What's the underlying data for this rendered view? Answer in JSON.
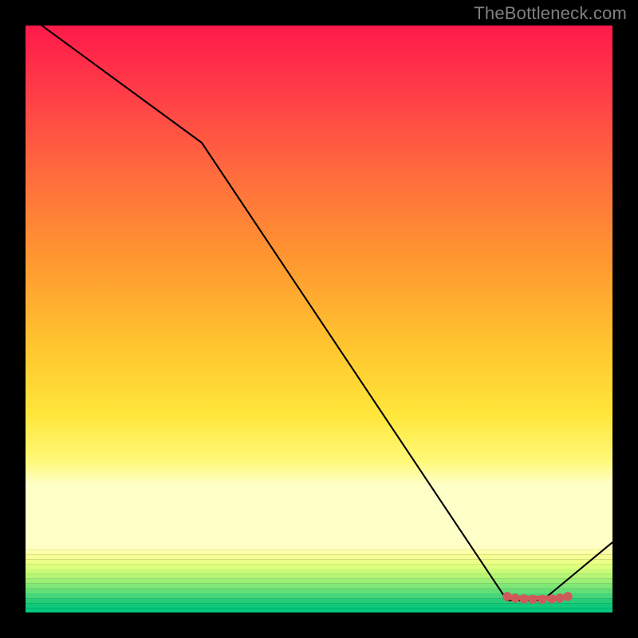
{
  "attribution": "TheBottleneck.com",
  "chart_data": {
    "type": "line",
    "title": "",
    "xlabel": "",
    "ylabel": "",
    "x_range": [
      0,
      100
    ],
    "y_range": [
      0,
      100
    ],
    "series": [
      {
        "name": "curve",
        "x": [
          0,
          30,
          82,
          88,
          100
        ],
        "y": [
          102,
          80,
          2,
          2,
          12
        ]
      }
    ],
    "marker_region": {
      "name": "highlight",
      "x_start": 82,
      "x_end": 92,
      "y": 2.5,
      "color": "#cf5a5a"
    },
    "background": {
      "type": "vertical-gradient-with-bands",
      "stops": [
        {
          "pos": 0.0,
          "color": "#ff1a4a"
        },
        {
          "pos": 0.5,
          "color": "#ff9a2b"
        },
        {
          "pos": 0.75,
          "color": "#ffe63a"
        },
        {
          "pos": 0.9,
          "color": "#ffff9a"
        },
        {
          "pos": 1.0,
          "color": "#0fd177"
        }
      ],
      "bands_start": 0.884,
      "bands": [
        "#fffec2",
        "#fdffa8",
        "#f7ff94",
        "#edff87",
        "#dcff7d",
        "#c9fb78",
        "#b3f676",
        "#9bef76",
        "#80e777",
        "#63de77",
        "#46d579",
        "#28cd79",
        "#11c97a",
        "#02c77c"
      ]
    }
  }
}
